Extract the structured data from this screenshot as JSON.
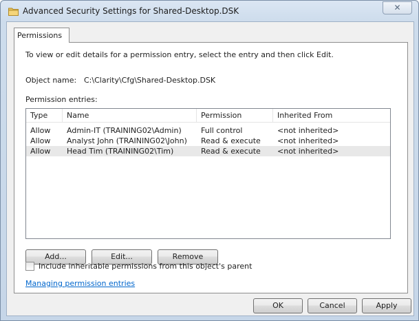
{
  "window": {
    "title": "Advanced Security Settings for Shared-Desktop.DSK",
    "close_glyph": "✕"
  },
  "tabs": [
    {
      "label": "Permissions"
    }
  ],
  "instructions": "To view or edit details for a permission entry, select the entry and then click Edit.",
  "object": {
    "label": "Object name:",
    "value": "C:\\Clarity\\Cfg\\Shared-Desktop.DSK"
  },
  "entries": {
    "label": "Permission entries:",
    "columns": [
      "Type",
      "Name",
      "Permission",
      "Inherited From"
    ],
    "rows": [
      {
        "type": "Allow",
        "name": "Admin-IT (TRAINING02\\Admin)",
        "permission": "Full control",
        "inherited": "<not inherited>"
      },
      {
        "type": "Allow",
        "name": "Analyst John (TRAINING02\\John)",
        "permission": "Read & execute",
        "inherited": "<not inherited>"
      },
      {
        "type": "Allow",
        "name": "Head Tim (TRAINING02\\Tim)",
        "permission": "Read & execute",
        "inherited": "<not inherited>"
      }
    ],
    "selected_row": 2
  },
  "actions": {
    "add": "Add...",
    "edit": "Edit...",
    "remove": "Remove"
  },
  "inherit_checkbox": {
    "label": "Include inheritable permissions from this object's parent",
    "checked": false
  },
  "help_link": "Managing permission entries",
  "footer": {
    "ok": "OK",
    "cancel": "Cancel",
    "apply": "Apply"
  },
  "colors": {
    "link": "#0066cc",
    "selection": "#e8e8e8",
    "window_frame": "#c6d6e8"
  },
  "icons": {
    "title": "folder-icon"
  }
}
